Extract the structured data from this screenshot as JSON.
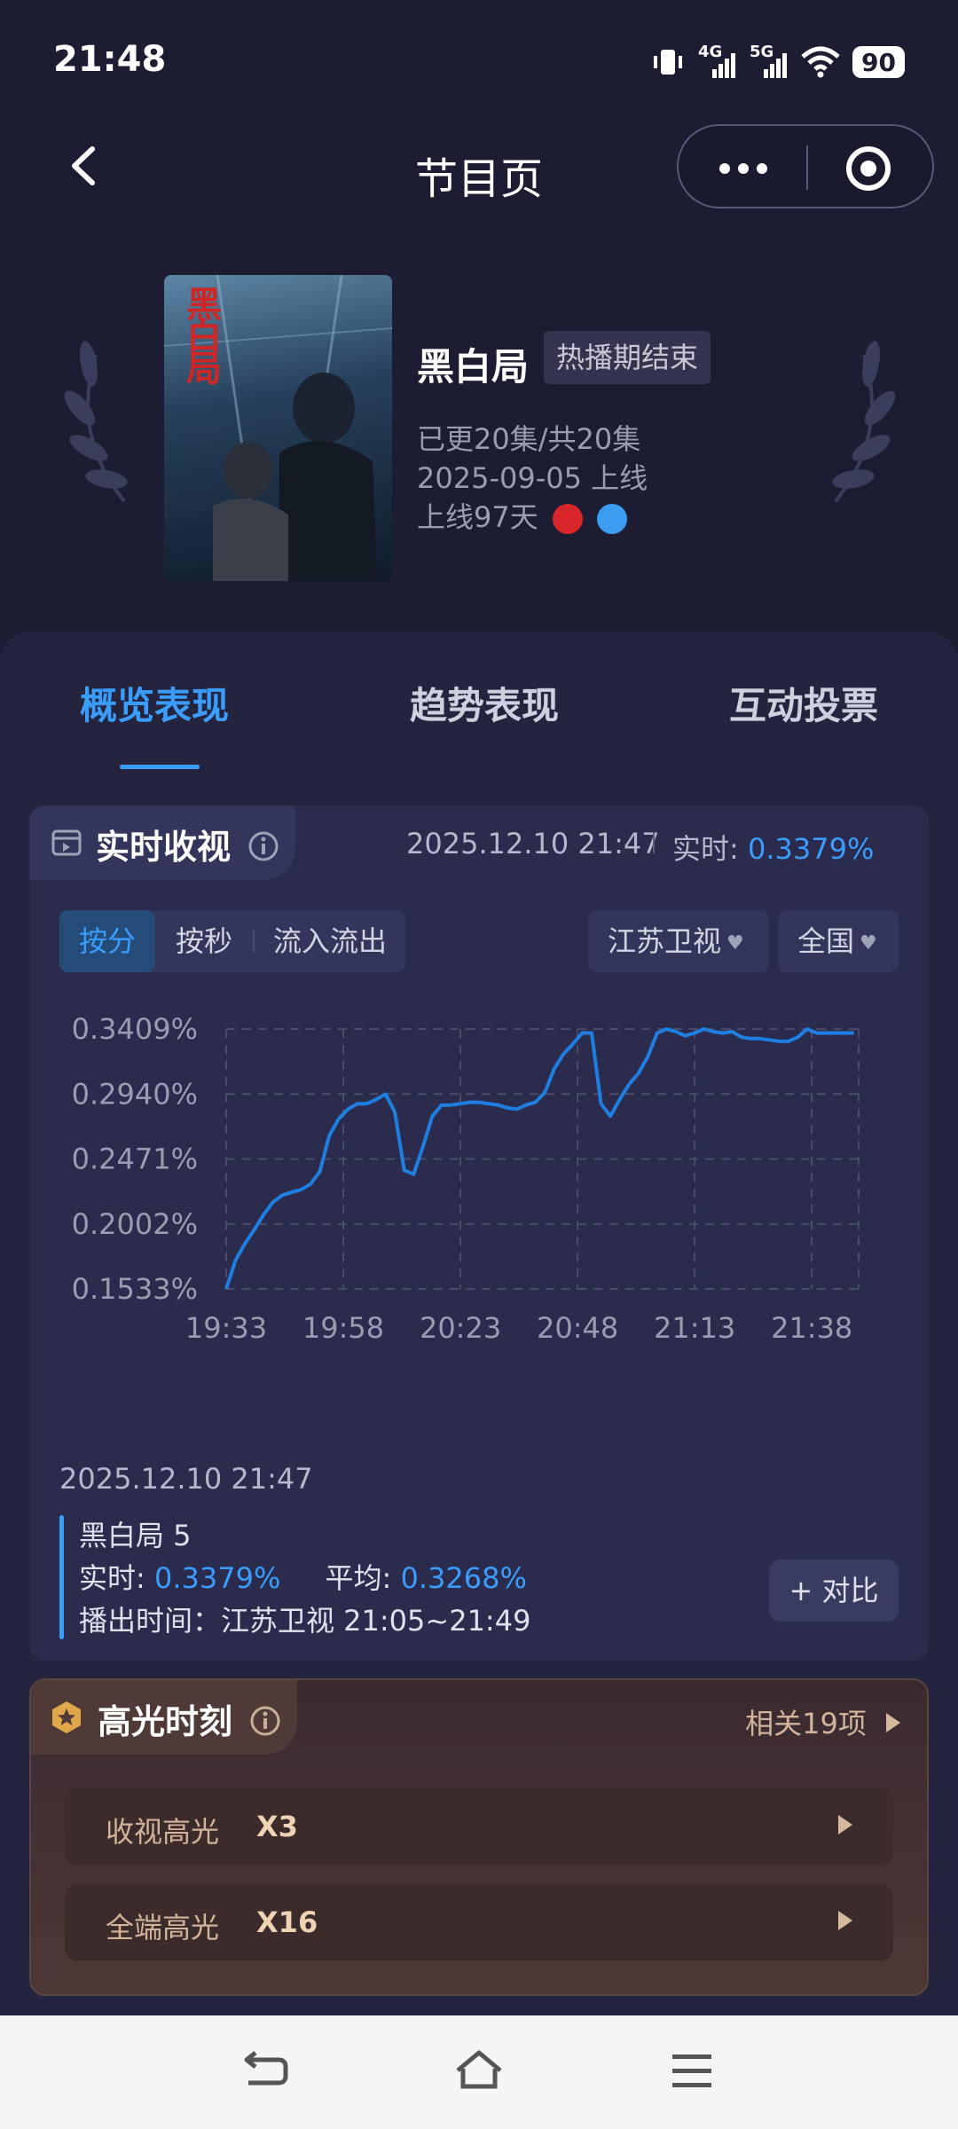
{
  "status": {
    "time": "21:48",
    "signal_4g": "4G",
    "signal_5g": "5G",
    "battery": "90"
  },
  "nav": {
    "title": "节目页"
  },
  "show": {
    "poster_title": "黑白局",
    "title": "黑白局",
    "badge": "热播期结束",
    "episodes": "已更20集/共20集",
    "premiere": "2025-09-05 上线",
    "days_online": "上线97天"
  },
  "tabs": [
    {
      "label": "概览表现",
      "active": true
    },
    {
      "label": "趋势表现",
      "active": false
    },
    {
      "label": "互动投票",
      "active": false
    }
  ],
  "realtime": {
    "title": "实时收视",
    "timestamp": "2025.12.10 21:47",
    "realtime_label": "实时:",
    "realtime_value": "0.3379%",
    "segments": [
      "按分",
      "按秒",
      "流入流出"
    ],
    "channel": "江苏卫视",
    "region": "全国",
    "footer_timestamp": "2025.12.10 21:47",
    "episode": "黑白局 5",
    "rt_label": "实时:",
    "rt_value": "0.3379%",
    "avg_label": "平均:",
    "avg_value": "0.3268%",
    "airtime": "播出时间：江苏卫视 21:05~21:49",
    "compare_button": "+ 对比"
  },
  "chart_data": {
    "type": "line",
    "x_tick_labels": [
      "19:33",
      "19:58",
      "20:23",
      "20:48",
      "21:13",
      "21:38"
    ],
    "y_tick_labels": [
      "0.3409%",
      "0.2940%",
      "0.2471%",
      "0.2002%",
      "0.1533%"
    ],
    "ylim": [
      0.1533,
      0.3409
    ],
    "grid": true,
    "color": "#1f7fe0",
    "x_minutes_since_1933": [
      0,
      2,
      4,
      6,
      8,
      10,
      12,
      14,
      16,
      18,
      20,
      22,
      24,
      26,
      28,
      30,
      32,
      34,
      36,
      38,
      40,
      42,
      44,
      46,
      48,
      50,
      52,
      54,
      56,
      58,
      60,
      62,
      64,
      66,
      68,
      70,
      72,
      74,
      76,
      78,
      80,
      82,
      84,
      86,
      88,
      90,
      92,
      94,
      96,
      98,
      100,
      102,
      104,
      106,
      108,
      110,
      112,
      114,
      116,
      118,
      120,
      122,
      124,
      126,
      128,
      130,
      132,
      134
    ],
    "values": [
      0.1533,
      0.174,
      0.186,
      0.196,
      0.207,
      0.216,
      0.221,
      0.223,
      0.225,
      0.229,
      0.238,
      0.264,
      0.276,
      0.283,
      0.287,
      0.287,
      0.29,
      0.294,
      0.281,
      0.239,
      0.236,
      0.256,
      0.278,
      0.286,
      0.286,
      0.287,
      0.288,
      0.288,
      0.287,
      0.286,
      0.284,
      0.283,
      0.286,
      0.288,
      0.295,
      0.312,
      0.323,
      0.33,
      0.338,
      0.338,
      0.287,
      0.278,
      0.29,
      0.301,
      0.309,
      0.321,
      0.338,
      0.3409,
      0.339,
      0.336,
      0.338,
      0.3409,
      0.339,
      0.338,
      0.339,
      0.335,
      0.334,
      0.334,
      0.333,
      0.332,
      0.332,
      0.335,
      0.3409,
      0.338,
      0.338,
      0.338,
      0.338,
      0.338
    ]
  },
  "highlights": {
    "title": "高光时刻",
    "related": "相关19项",
    "rows": [
      {
        "label": "收视高光",
        "value": "X3"
      },
      {
        "label": "全端高光",
        "value": "X16"
      }
    ]
  }
}
